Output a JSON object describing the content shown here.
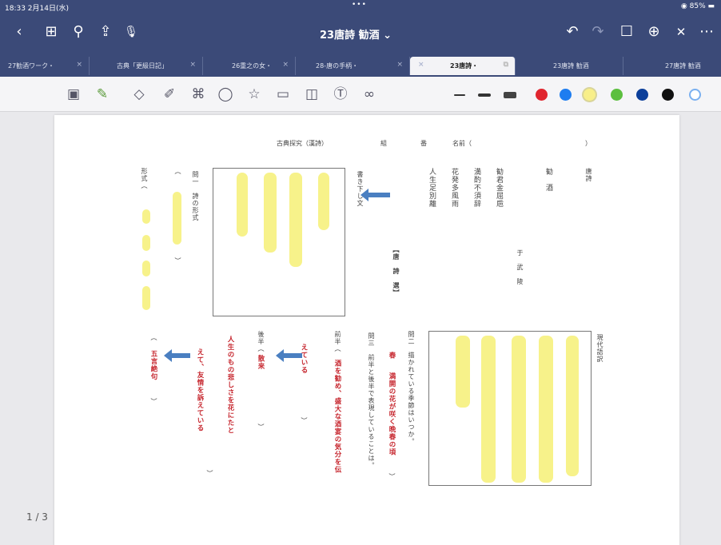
{
  "status": {
    "time": "18:33  2月14日(水)",
    "dots": "•••",
    "battery": "◉ 85% ▬"
  },
  "nav": {
    "title": "23唐詩  勧酒 ⌄",
    "back": "‹",
    "grid": "⊞",
    "search": "⚲",
    "share": "⇪",
    "mic": "🎙",
    "undo": "↶",
    "redo": "↷",
    "bookmark": "☐",
    "add_page": "⊕",
    "close": "✕",
    "more": "⋯"
  },
  "tabs": [
    {
      "label": "27勧酒ワーク・",
      "active": false
    },
    {
      "label": "古典「更級日記」",
      "active": false
    },
    {
      "label": "26重之の女・",
      "active": false
    },
    {
      "label": "28-唐の手柄・",
      "active": false
    },
    {
      "label": "23唐詩・",
      "active": true
    },
    {
      "label": "23唐詩  勧酒",
      "active": false
    },
    {
      "label": "27唐詩  勧酒",
      "active": false
    }
  ],
  "tools": [
    "image-tool",
    "pen-tool",
    "eraser-tool",
    "highlighter-tool",
    "lasso-tool",
    "comment-tool",
    "stamp-tool",
    "photo-tool",
    "camera-tool",
    "textbox-tool",
    "link-tool"
  ],
  "colors": {
    "swatches": [
      "#e0262f",
      "#1e7df0",
      "#f8ef8a",
      "#5cbf3f",
      "#0c3f9a",
      "#111111"
    ],
    "highlight": "#f7f28a",
    "arrow": "#4a7fc1",
    "answer": "#c6262e"
  },
  "document": {
    "header": "古典探究（漢詩）",
    "class_label": "組",
    "number_label": "番",
    "name_label": "名前（",
    "name_close": "）",
    "genre": "唐詩",
    "poem_title": "勧　酒",
    "poet": "于　武　陵",
    "lines": [
      "勧君金屈巵",
      "満酌不須辞",
      "花発多風雨",
      "人生足別離"
    ],
    "tang_label": "【唐　詩　選】",
    "reading_label": "書き下し文",
    "modern_label": "現代語訳",
    "q1_label": "問一　詩の形式",
    "q2_label": "問二　",
    "q2_body": "描かれている季節はいつか。",
    "q3_body": "問三　前半と後半で表現していることは。",
    "answer_spring": "春　",
    "answer_spring_detail": "満開の花が咲く晩春の頃",
    "pre_label": "前半（",
    "answer_pre": "酒を勧め、盛大な酒宴の気分を伝",
    "answer_pre2": "えている",
    "post_label": "後半（",
    "answer_post": "散来",
    "answer_post2": "人生のもの悲しさを花にたと",
    "answer_post3": "えて、友情を訴えている",
    "format_label": "形式（",
    "answer_format": "五言絶句",
    "close_paren": "）"
  },
  "pagination": {
    "label": "1 / 3"
  }
}
